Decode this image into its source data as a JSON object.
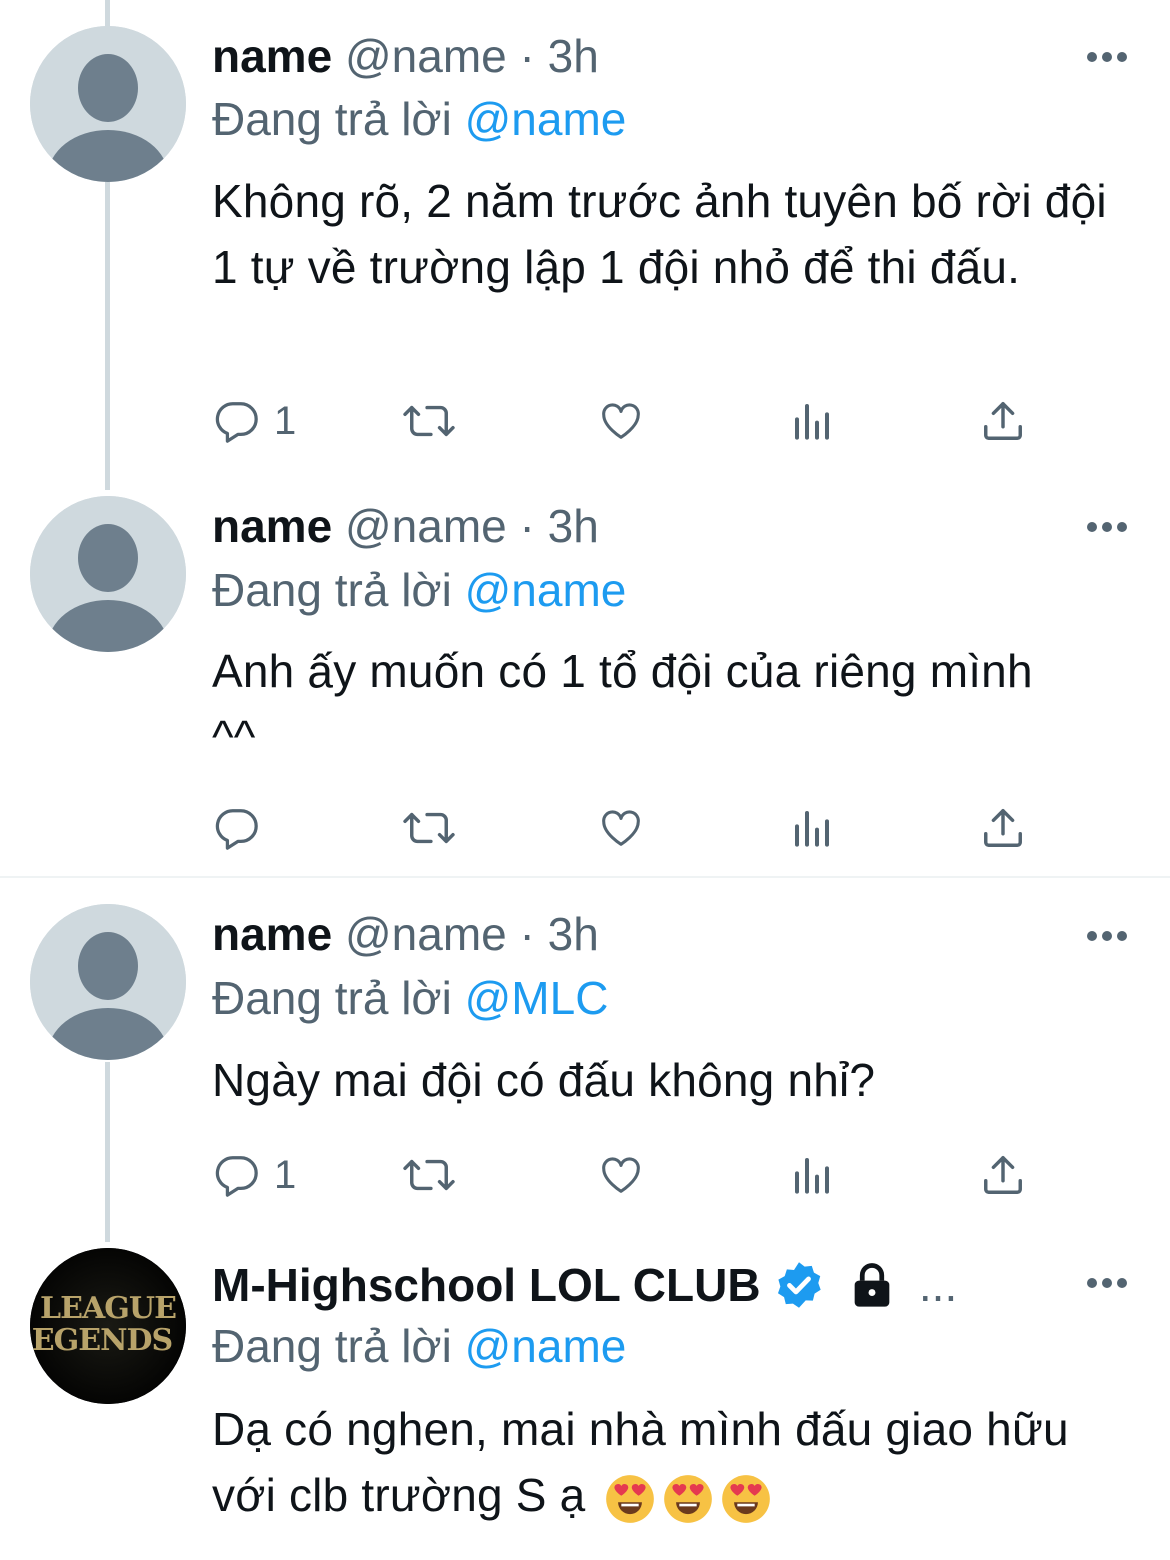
{
  "tweets": [
    {
      "name": "name",
      "handle": "@name",
      "separator": "·",
      "time": "3h",
      "reply_prefix": "Đang trả lời",
      "reply_to": "@name",
      "text": "Không rõ, 2 năm trước ảnh tuyên bố rời đội 1 tự về trường lập 1 đội nhỏ để thi đấu.",
      "reply_count": "1",
      "avatar_icon": "default-avatar-icon"
    },
    {
      "name": "name",
      "handle": "@name",
      "separator": "·",
      "time": "3h",
      "reply_prefix": "Đang trả lời",
      "reply_to": "@name",
      "text": "Anh ấy muốn có 1 tổ đội của riêng mình ^^",
      "reply_count": "",
      "avatar_icon": "default-avatar-icon"
    },
    {
      "name": "name",
      "handle": "@name",
      "separator": "·",
      "time": "3h",
      "reply_prefix": "Đang trả lời",
      "reply_to": "@MLC",
      "text": "Ngày mai đội có đấu không nhỉ?",
      "reply_count": "1",
      "avatar_icon": "default-avatar-icon"
    },
    {
      "name": "M-Highschool LOL CLUB",
      "ellipsis": "...",
      "verified_icon": "verified-badge-icon",
      "protected_icon": "lock-icon",
      "reply_prefix": "Đang trả lời",
      "reply_to": "@name",
      "text": "Dạ có nghen, mai nhà mình đấu giao hữu với clb trường S ạ",
      "emoji": [
        "heart-eyes-emoji",
        "heart-eyes-emoji",
        "heart-eyes-emoji"
      ],
      "avatar_logo_lines": [
        "LEAGUE",
        "EGENDS"
      ]
    }
  ],
  "action_icons": [
    "reply-icon",
    "retweet-icon",
    "like-icon",
    "views-icon",
    "share-icon"
  ],
  "colors": {
    "accent": "#1d9bf0",
    "secondary_text": "#536471",
    "thread_line": "#cfd9de",
    "avatar_bg": "#cfd9de",
    "avatar_figure": "#6e7f8d"
  }
}
